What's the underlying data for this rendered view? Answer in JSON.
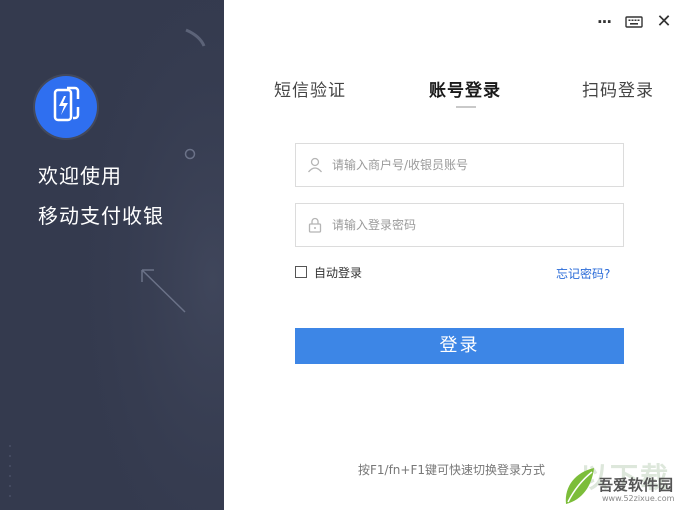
{
  "window_controls": {
    "more_icon": "more-dots-icon",
    "keyboard_icon": "keyboard-icon",
    "close_icon": "close-icon",
    "more_glyph": "···",
    "keyboard_glyph": "⌨",
    "close_glyph": "✕"
  },
  "brand": {
    "logo_icon": "phone-lightning-icon",
    "welcome_line1": "欢迎使用",
    "welcome_line2": "移动支付收银",
    "colors": {
      "panel": "#343a4e",
      "logo": "#2f6ff0"
    }
  },
  "tabs": [
    {
      "label": "短信验证",
      "active": false
    },
    {
      "label": "账号登录",
      "active": true
    },
    {
      "label": "扫码登录",
      "active": false
    }
  ],
  "form": {
    "username": {
      "value": "",
      "placeholder": "请输入商户号/收银员账号",
      "icon": "user-icon"
    },
    "password": {
      "value": "",
      "placeholder": "请输入登录密码",
      "icon": "lock-icon"
    },
    "auto_login": {
      "label": "自动登录",
      "checked": false
    },
    "forgot_label": "忘记密码?",
    "submit_label": "登录",
    "accent": "#3d86e6"
  },
  "hint": "按F1/fn+F1键可快速切换登录方式",
  "watermark": {
    "big": "以下载",
    "name": "吾爱软件园",
    "url": "www.52zixue.com"
  }
}
